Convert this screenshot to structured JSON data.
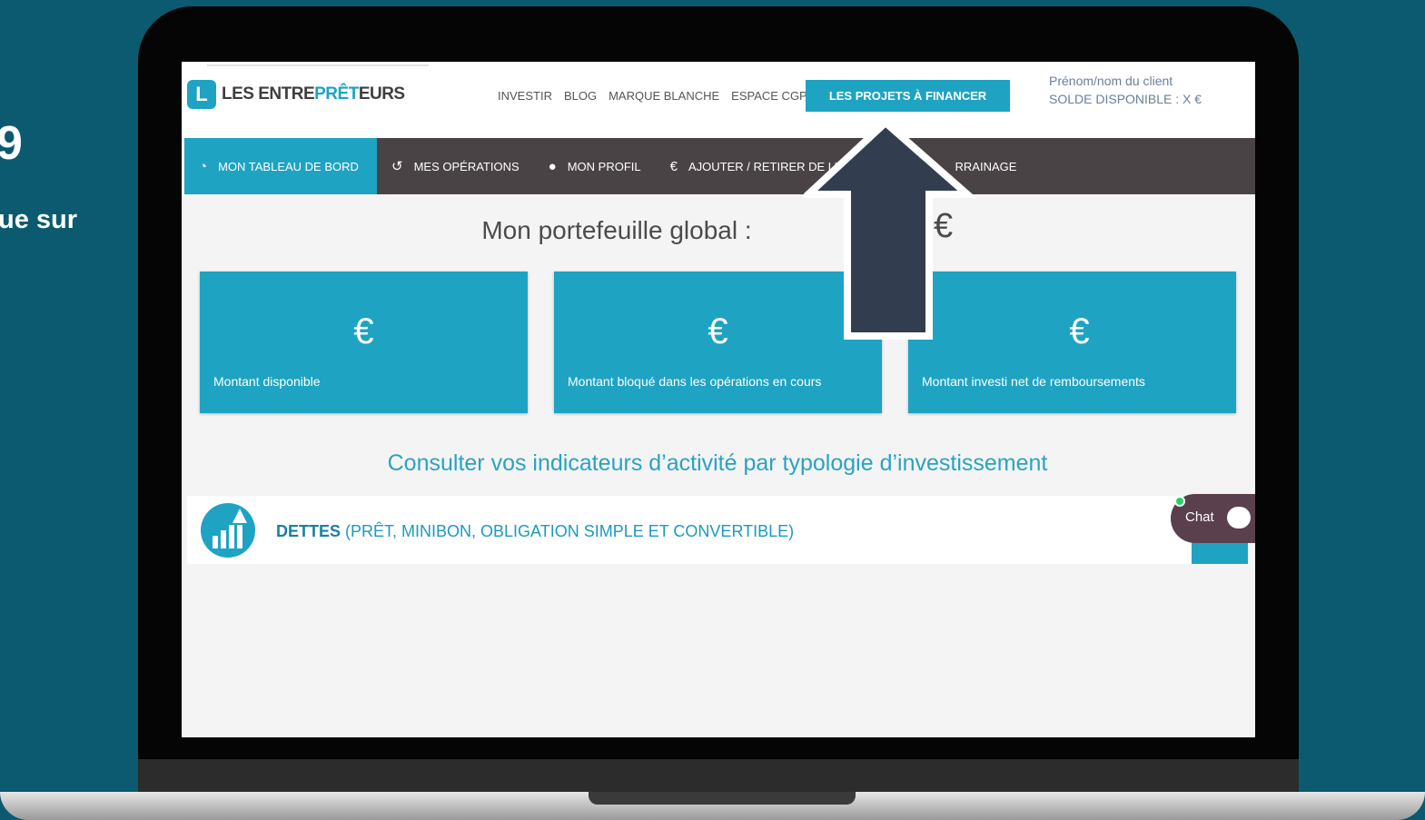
{
  "slide": {
    "number": "9",
    "text": "ue sur"
  },
  "header": {
    "logo_mark": "L",
    "logo_text_main": "LES ENTRE",
    "logo_text_accent": "PRÊT",
    "logo_text_end": "EURS",
    "nav": [
      "INVESTIR",
      "BLOG",
      "MARQUE BLANCHE",
      "ESPACE CGP"
    ],
    "cta_label": "LES PROJETS À FINANCER",
    "client_name": "Prénom/nom du client",
    "client_balance": "SOLDE DISPONIBLE : X  €"
  },
  "mainnav": {
    "items": [
      {
        "label": "MON TABLEAU DE BORD",
        "icon": "dashboard-icon",
        "active": true
      },
      {
        "label": "MES OPÉRATIONS",
        "icon": "history-icon",
        "active": false
      },
      {
        "label": "MON PROFIL",
        "icon": "user-icon",
        "active": false
      },
      {
        "label": "AJOUTER / RETIRER DE L'",
        "icon": "euro-transfer-icon",
        "active": false
      },
      {
        "label": "RRAINAGE",
        "icon": "",
        "active": false
      }
    ]
  },
  "portfolio": {
    "title": "Mon portefeuille global :",
    "currency": "€"
  },
  "cards": [
    {
      "value": "€",
      "label": "Montant disponible"
    },
    {
      "value": "€",
      "label": "Montant bloqué dans les opérations en cours"
    },
    {
      "value": "€",
      "label": "Montant investi net de remboursements"
    }
  ],
  "indicators_title": "Consulter vos indicateurs d’activité par typologie d’investissement",
  "debt": {
    "title": "DETTES",
    "subtitle": "(PRÊT, MINIBON, OBLIGATION SIMPLE ET CONVERTIBLE)"
  },
  "chat": {
    "label": "Chat"
  },
  "colors": {
    "accent": "#1ea3c3",
    "nav_dark": "#4a4345",
    "background": "#0b5a70",
    "arrow": "#323e4f"
  }
}
